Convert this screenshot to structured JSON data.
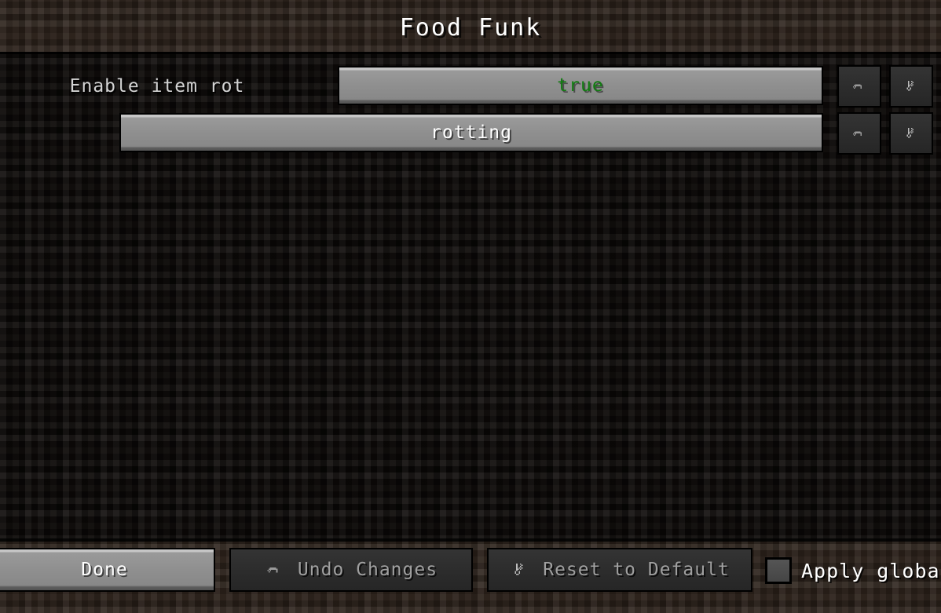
{
  "window": {
    "title": "Food Funk"
  },
  "config_rows": [
    {
      "label": "Enable item rot",
      "value": "true",
      "value_type": "boolean",
      "undo_icon": "undo-arrow-icon",
      "reset_icon": "reset-key-icon"
    },
    {
      "label": "",
      "value": "rotting",
      "value_type": "string",
      "undo_icon": "undo-arrow-icon",
      "reset_icon": "reset-key-icon"
    }
  ],
  "footer": {
    "done_label": "Done",
    "undo_changes_label": "Undo Changes",
    "reset_default_label": "Reset to Default",
    "apply_global_label": "Apply global",
    "apply_global_checked": false,
    "undo_icon": "undo-arrow-icon",
    "reset_icon": "reset-key-icon"
  },
  "colors": {
    "true_value": "#107c10",
    "widget_light": "#8b8b8b",
    "widget_dark": "#2e2e2e",
    "label_text": "#d4d4d4",
    "title_text": "#ffffff",
    "dirt_header": "#2b211a",
    "dirt_body": "#0e0b09"
  }
}
